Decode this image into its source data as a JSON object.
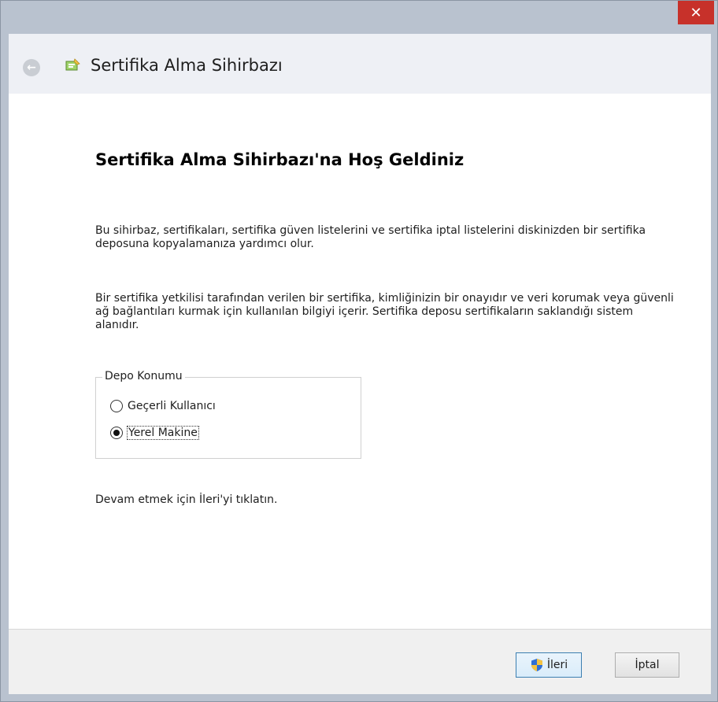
{
  "window": {
    "close_label": "✕"
  },
  "header": {
    "title": "Sertifika Alma Sihirbazı"
  },
  "main": {
    "heading": "Sertifika Alma Sihirbazı'na Hoş Geldiniz",
    "paragraph1": "Bu sihirbaz, sertifikaları, sertifika güven listelerini ve sertifika iptal listelerini diskinizden bir sertifika deposuna kopyalamanıza yardımcı olur.",
    "paragraph2": "Bir sertifika yetkilisi tarafından verilen bir sertifika, kimliğinizin bir onayıdır ve veri korumak veya güvenli ağ bağlantıları kurmak için kullanılan bilgiyi içerir. Sertifika deposu sertifikaların saklandığı sistem alanıdır.",
    "store_location": {
      "label": "Depo Konumu",
      "options": [
        {
          "label": "Geçerli Kullanıcı",
          "selected": false
        },
        {
          "label": "Yerel Makine",
          "selected": true
        }
      ]
    },
    "hint": "Devam etmek için İleri'yi tıklatın."
  },
  "footer": {
    "next_label": "İleri",
    "cancel_label": "İptal"
  },
  "icons": {
    "back": "back-arrow-icon",
    "wizard": "certificate-wizard-icon",
    "shield": "uac-shield-icon"
  },
  "colors": {
    "close_button": "#c7312a",
    "window_frame": "#b9c2cf",
    "header_bg": "#eef0f5",
    "footer_bg": "#f0f0f0"
  }
}
